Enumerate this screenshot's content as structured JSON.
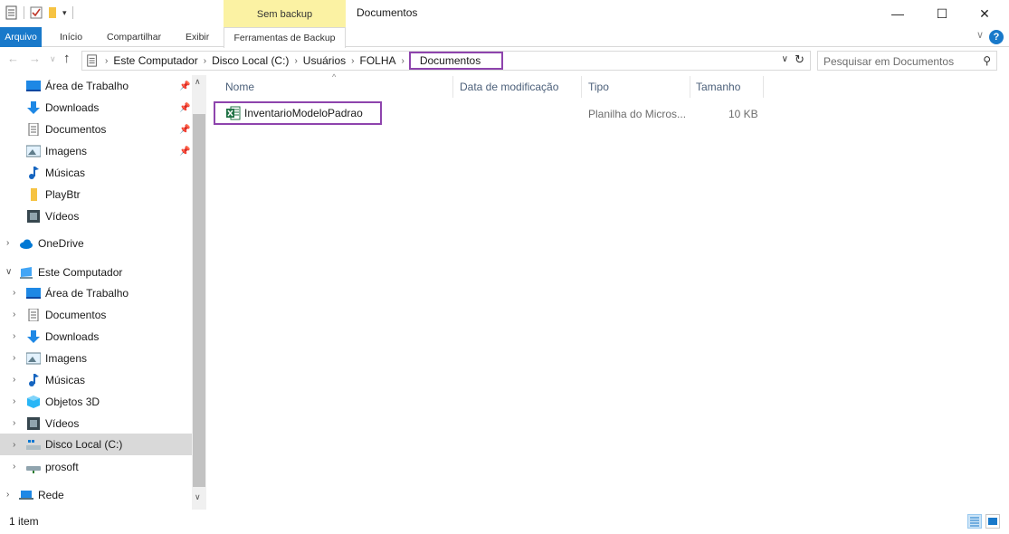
{
  "window": {
    "title": "Documentos",
    "context_tab": "Sem backup",
    "controls": {
      "minimize": "—",
      "maximize": "☐",
      "close": "✕"
    }
  },
  "ribbon": {
    "tabs": [
      "Arquivo",
      "Início",
      "Compartilhar",
      "Exibir",
      "Ferramentas de Backup"
    ],
    "help": "?"
  },
  "address": {
    "crumbs": [
      "Este Computador",
      "Disco Local (C:)",
      "Usuários",
      "FOLHA",
      "Documentos"
    ]
  },
  "search": {
    "placeholder": "Pesquisar em Documentos"
  },
  "nav": {
    "quick_access": [
      {
        "label": "Área de Trabalho",
        "icon": "desktop-icon",
        "pinned": true
      },
      {
        "label": "Downloads",
        "icon": "download-icon",
        "pinned": true
      },
      {
        "label": "Documentos",
        "icon": "documents-icon",
        "pinned": true
      },
      {
        "label": "Imagens",
        "icon": "pictures-icon",
        "pinned": true
      },
      {
        "label": "Músicas",
        "icon": "music-icon",
        "pinned": false
      },
      {
        "label": "PlayBtr",
        "icon": "folder-icon",
        "pinned": false
      },
      {
        "label": "Vídeos",
        "icon": "videos-icon",
        "pinned": false
      }
    ],
    "onedrive": "OneDrive",
    "this_pc": "Este Computador",
    "this_pc_items": [
      {
        "label": "Área de Trabalho",
        "icon": "desktop-icon"
      },
      {
        "label": "Documentos",
        "icon": "documents-icon"
      },
      {
        "label": "Downloads",
        "icon": "download-icon"
      },
      {
        "label": "Imagens",
        "icon": "pictures-icon"
      },
      {
        "label": "Músicas",
        "icon": "music-icon"
      },
      {
        "label": "Objetos 3D",
        "icon": "objects3d-icon"
      },
      {
        "label": "Vídeos",
        "icon": "videos-icon"
      },
      {
        "label": "Disco Local (C:)",
        "icon": "drive-icon",
        "selected": true
      },
      {
        "label": "prosoft",
        "icon": "network-drive-icon"
      }
    ],
    "network": "Rede"
  },
  "columns": {
    "name": "Nome",
    "modified": "Data de modificação",
    "type": "Tipo",
    "size": "Tamanho"
  },
  "files": [
    {
      "name": "InventarioModeloPadrao",
      "modified": "",
      "type": "Planilha do Micros...",
      "size": "10 KB",
      "icon": "excel-icon"
    }
  ],
  "status": {
    "item_count": "1 item"
  },
  "colors": {
    "accent": "#1979ca",
    "highlight_box": "#8e44ad",
    "context_tab": "#fbf2a3"
  }
}
